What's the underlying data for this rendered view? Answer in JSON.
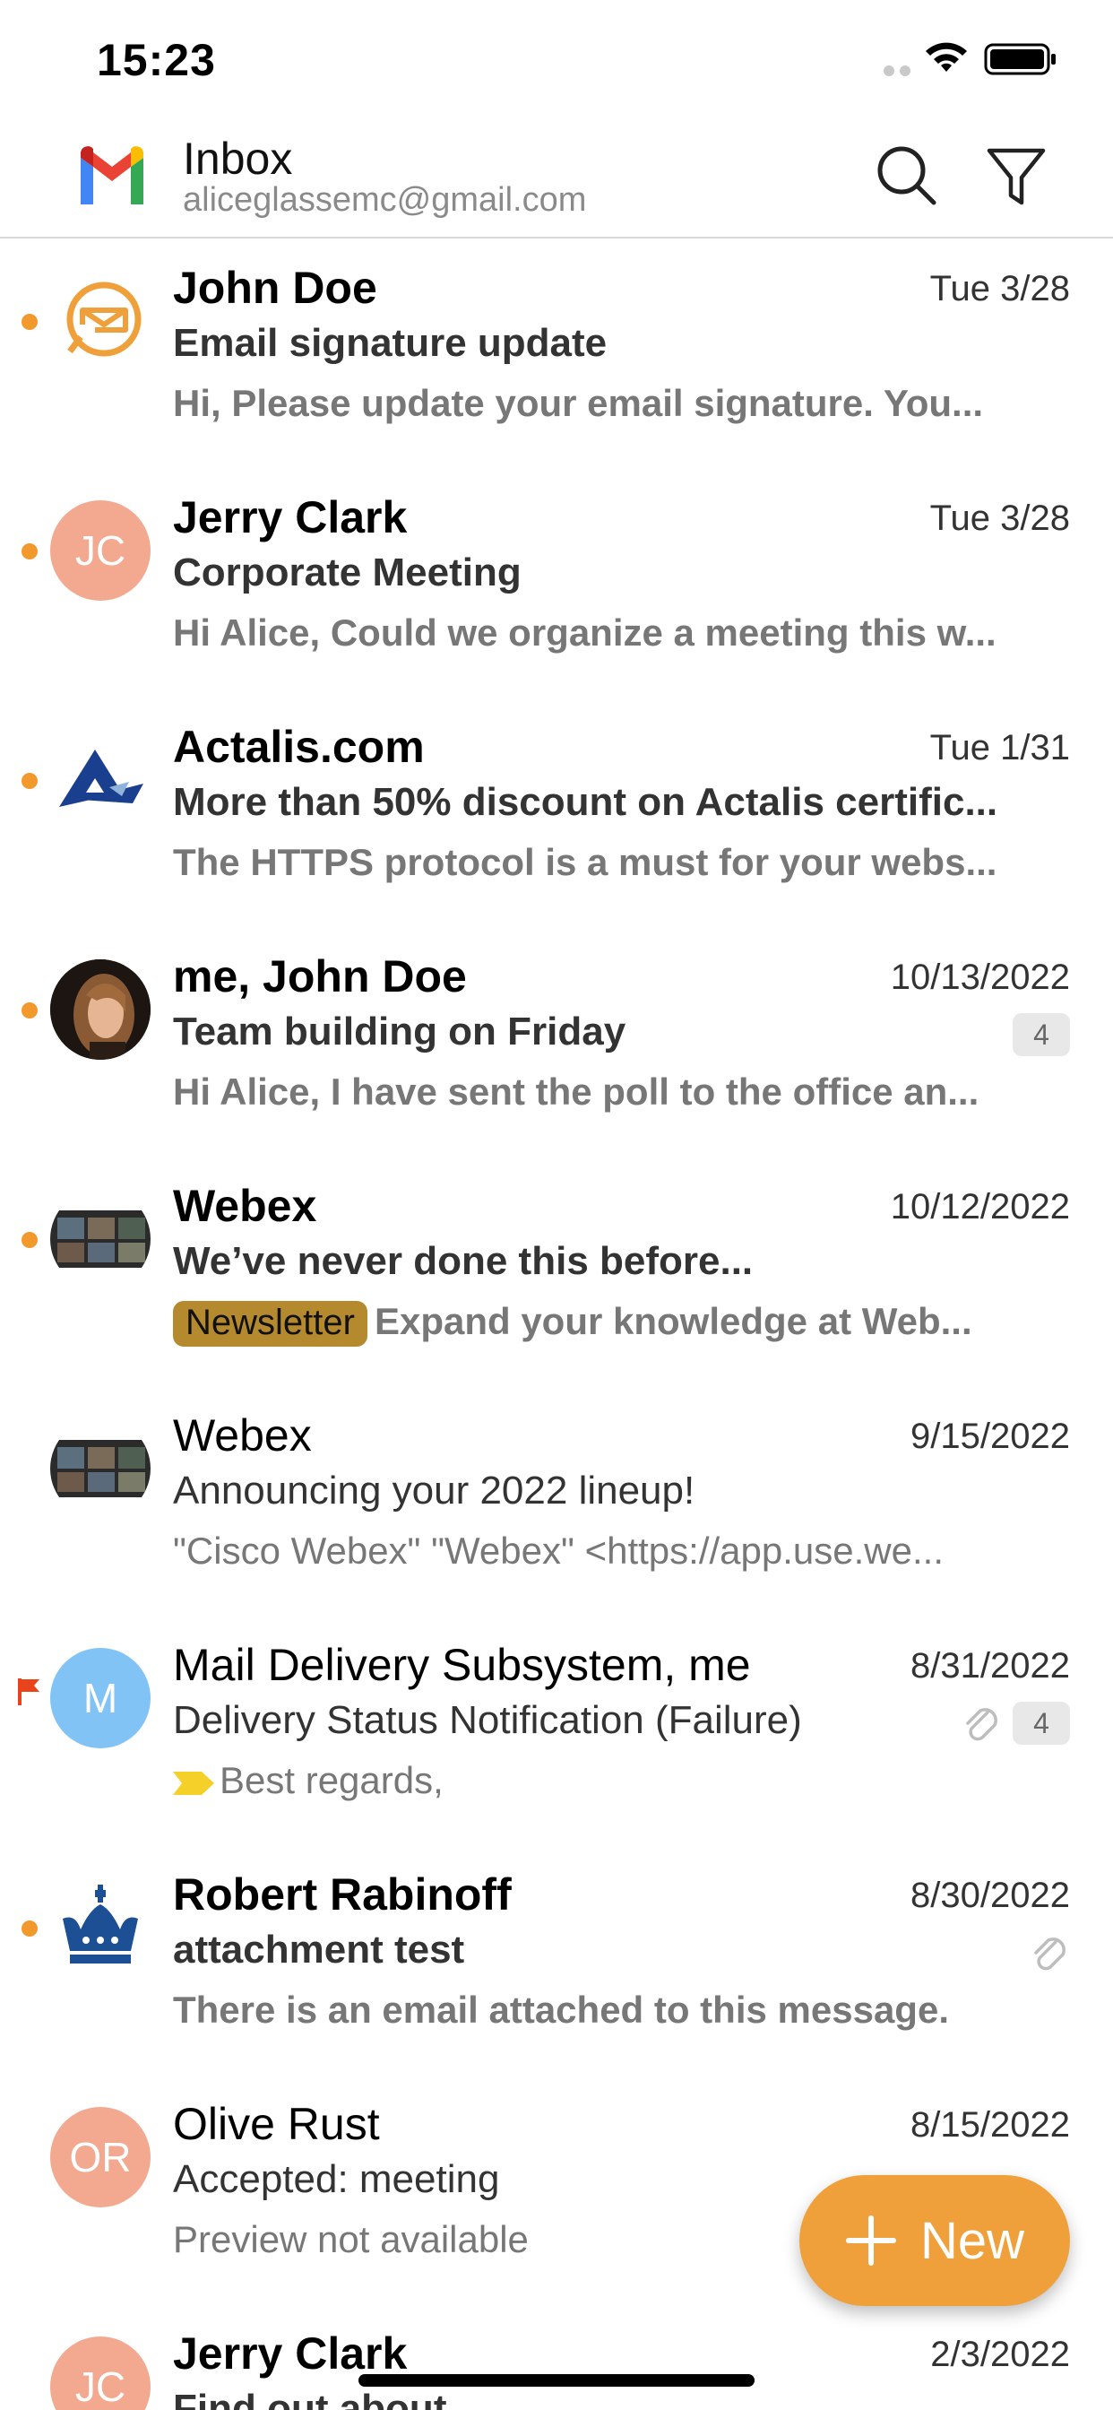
{
  "status_bar": {
    "time": "15:23"
  },
  "header": {
    "title": "Inbox",
    "account": "aliceglassemc@gmail.com"
  },
  "emails": [
    {
      "sender": "John Doe",
      "date": "Tue 3/28",
      "subject": "Email signature update",
      "preview": "Hi, Please update your email signature. You...",
      "unread": true,
      "avatar_icon": "envelope-logo-icon"
    },
    {
      "sender": "Jerry Clark",
      "date": "Tue 3/28",
      "subject": "Corporate Meeting",
      "preview": "Hi Alice, Could we organize a meeting this w...",
      "unread": true,
      "avatar_initials": "JC",
      "avatar_color": "#f2a98f"
    },
    {
      "sender": "Actalis.com",
      "date": "Tue 1/31",
      "subject": "More than 50% discount on Actalis certific...",
      "preview": "The HTTPS protocol is a must for your webs...",
      "unread": true,
      "avatar_icon": "actalis-logo-icon"
    },
    {
      "sender": "me, John Doe",
      "date": "10/13/2022",
      "subject": "Team building on Friday",
      "preview": "Hi Alice, I have sent the poll to the office an...",
      "unread": true,
      "count": "4",
      "avatar_icon": "person-photo"
    },
    {
      "sender": "Webex",
      "date": "10/12/2022",
      "subject": "We’ve never done this before...",
      "tag": "Newsletter",
      "preview": "Expand your knowledge at Web...",
      "unread": true,
      "avatar_icon": "webex-photo"
    },
    {
      "sender": "Webex",
      "date": "9/15/2022",
      "subject": "Announcing your 2022 lineup!",
      "preview": "\"Cisco Webex\"  \"Webex\" <https://app.use.we...",
      "unread": false,
      "avatar_icon": "webex-photo"
    },
    {
      "sender": "Mail Delivery Subsystem, me",
      "date": "8/31/2022",
      "subject": "Delivery Status Notification (Failure)",
      "preview": "Best regards,",
      "unread": false,
      "flagged": true,
      "count": "4",
      "has_attachment": true,
      "avatar_initials": "M",
      "avatar_color": "#82c3f5"
    },
    {
      "sender": "Robert Rabinoff",
      "date": "8/30/2022",
      "subject": "attachment test",
      "preview": "There is an email attached to this message.",
      "unread": true,
      "has_attachment": true,
      "avatar_icon": "crown-logo-icon"
    },
    {
      "sender": "Olive Rust",
      "date": "8/15/2022",
      "subject": "Accepted: meeting",
      "preview": "Preview not available",
      "unread": false,
      "avatar_initials": "OR",
      "avatar_color": "#f2a98f"
    },
    {
      "sender": "Jerry Clark",
      "date": "2/3/2022",
      "subject": "Find out about",
      "preview": "",
      "unread": false,
      "avatar_initials": "JC",
      "avatar_color": "#f2a98f"
    }
  ],
  "fab": {
    "label": "New"
  },
  "colors": {
    "accent": "#f0a03a",
    "unread_dot": "#f2992e",
    "tag_newsletter": "#b58a2e"
  }
}
